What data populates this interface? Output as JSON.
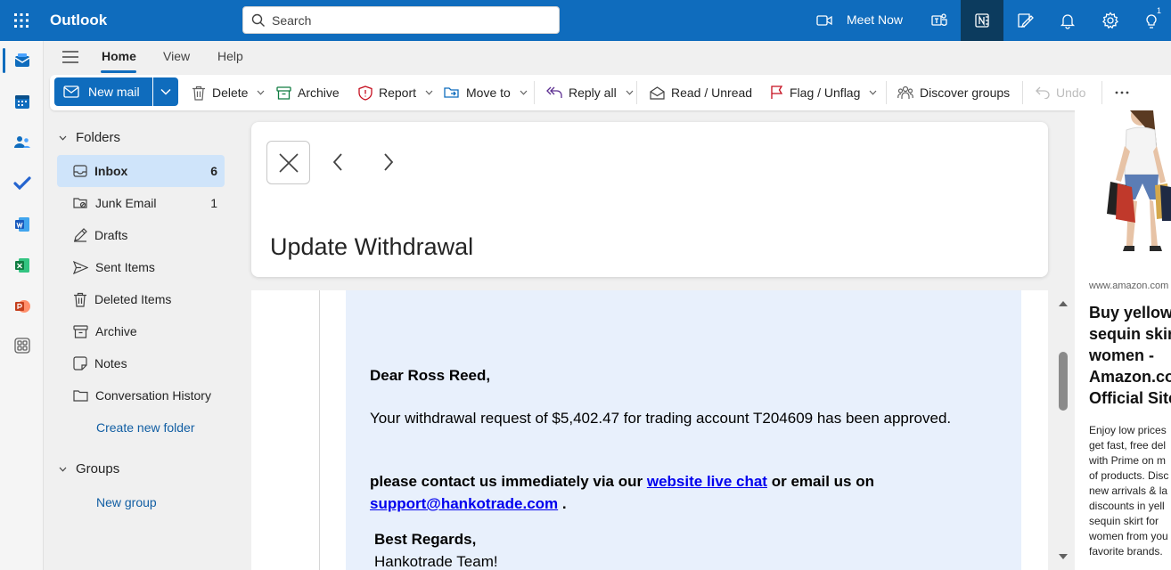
{
  "app": {
    "title": "Outlook"
  },
  "search": {
    "placeholder": "Search"
  },
  "topbar": {
    "meet_now": "Meet Now",
    "tips_badge": "1"
  },
  "ribbon": {
    "tabs": [
      "Home",
      "View",
      "Help"
    ]
  },
  "toolbar": {
    "new_mail": "New mail",
    "delete": "Delete",
    "archive": "Archive",
    "report": "Report",
    "move_to": "Move to",
    "reply_all": "Reply all",
    "read_unread": "Read / Unread",
    "flag_unflag": "Flag / Unflag",
    "discover_groups": "Discover groups",
    "undo": "Undo"
  },
  "folders": {
    "header": "Folders",
    "items": [
      {
        "label": "Inbox",
        "count": "6"
      },
      {
        "label": "Junk Email",
        "count": "1"
      },
      {
        "label": "Drafts",
        "count": ""
      },
      {
        "label": "Sent Items",
        "count": ""
      },
      {
        "label": "Deleted Items",
        "count": ""
      },
      {
        "label": "Archive",
        "count": ""
      },
      {
        "label": "Notes",
        "count": ""
      },
      {
        "label": "Conversation History",
        "count": ""
      }
    ],
    "create_new": "Create new folder",
    "groups_header": "Groups",
    "new_group": "New group"
  },
  "message": {
    "subject": "Update Withdrawal",
    "greeting": "Dear Ross Reed,",
    "line1": "Your withdrawal request of $5,402.47 for trading account T204609 has been approved.",
    "contact_pre": "please contact us immediately via our",
    "contact_link": "website live chat",
    "contact_mid": "or email us on",
    "email_link": "support@hankotrade.com",
    "contact_end": ".",
    "regards": "Best Regards,",
    "team": "Hankotrade Team!"
  },
  "ad": {
    "source": "www.amazon.com",
    "headline_lines": [
      "Buy yellow",
      "sequin skirt",
      "women -",
      "Amazon.com",
      "Official Site"
    ],
    "description_lines": [
      "Enjoy low prices",
      "get fast, free del",
      "with Prime on m",
      "of products. Disc",
      "new arrivals & la",
      "discounts in yell",
      "sequin skirt for",
      "women from you",
      "favorite brands."
    ]
  },
  "colors": {
    "brand": "#0f6cbd",
    "selected_folder": "#cfe4fa",
    "mail_body_bg": "#e8f0fc",
    "link": "#0000ee"
  }
}
